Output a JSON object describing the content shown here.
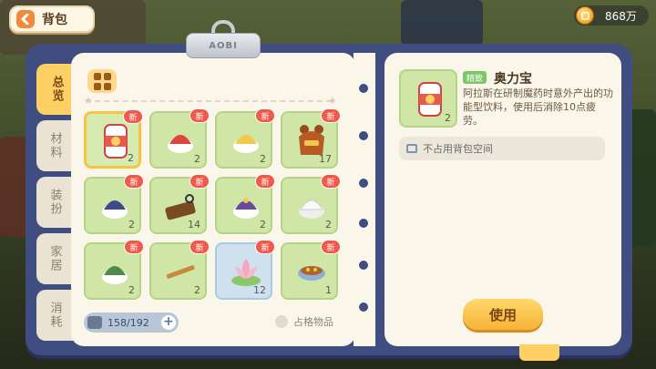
{
  "header": {
    "back_label": "背包",
    "currency_value": "868万"
  },
  "clip": {
    "label": "AOBI"
  },
  "tabs": [
    {
      "label": "总览",
      "active": true
    },
    {
      "label": "材料",
      "active": false
    },
    {
      "label": "装扮",
      "active": false
    },
    {
      "label": "家居",
      "active": false
    },
    {
      "label": "消耗",
      "active": false
    }
  ],
  "inventory": {
    "new_label": "新",
    "items": [
      {
        "name": "aolibao-can-icon",
        "qty": "2",
        "new": true,
        "selected": true
      },
      {
        "name": "red-cap-icon",
        "qty": "2",
        "new": true
      },
      {
        "name": "yellow-cap-icon",
        "qty": "2",
        "new": true
      },
      {
        "name": "brown-bear-costume-icon",
        "qty": "17",
        "new": true
      },
      {
        "name": "navy-cap-icon",
        "qty": "2",
        "new": true
      },
      {
        "name": "wooden-board-icon",
        "qty": "14",
        "new": true
      },
      {
        "name": "purple-cap-icon",
        "qty": "2",
        "new": true
      },
      {
        "name": "white-cap-icon",
        "qty": "2",
        "new": true
      },
      {
        "name": "green-cap-icon",
        "qty": "2",
        "new": true
      },
      {
        "name": "bamboo-flute-icon",
        "qty": "2",
        "new": true
      },
      {
        "name": "lotus-flower-icon",
        "qty": "12",
        "new": true
      },
      {
        "name": "food-bowl-icon",
        "qty": "1",
        "new": true
      }
    ],
    "capacity": "158/192",
    "occupy_label": "占格物品"
  },
  "detail": {
    "quality": "精致",
    "name": "奥力宝",
    "qty": "2",
    "description": "阿拉斯在研制魔药时意外产出的功能型饮料，使用后消除10点疲劳。",
    "no_space": "不占用背包空间",
    "use_label": "使用"
  },
  "colors": {
    "frame": "#3f4d80",
    "panel": "#fbf6ea",
    "active_tab": "#ffd064",
    "cell_green": "#cfe6a6",
    "new_badge": "#ef5a4a",
    "use_button": "#f5b33a"
  }
}
